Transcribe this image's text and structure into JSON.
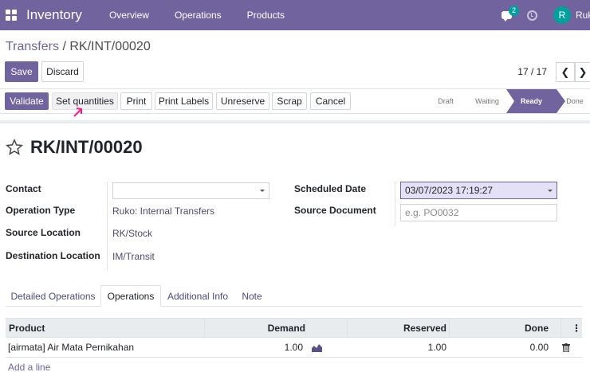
{
  "navbar": {
    "app_name": "Inventory",
    "menu": [
      "Overview",
      "Operations",
      "Products"
    ],
    "chat_count": "2",
    "user_initial": "R",
    "user_name": "Ruko"
  },
  "breadcrumb": {
    "parent": "Transfers",
    "separator": "/",
    "current": "RK/INT/00020"
  },
  "form_actions": {
    "save": "Save",
    "discard": "Discard"
  },
  "pager": {
    "value": "17 / 17"
  },
  "header_buttons": {
    "validate": "Validate",
    "set_quantities": "Set quantities",
    "print": "Print",
    "print_labels": "Print Labels",
    "unreserve": "Unreserve",
    "scrap": "Scrap",
    "cancel": "Cancel"
  },
  "status_stages": {
    "draft": "Draft",
    "waiting": "Waiting",
    "ready": "Ready",
    "done": "Done",
    "current": "Ready"
  },
  "record": {
    "title": "RK/INT/00020"
  },
  "fields": {
    "contact_label": "Contact",
    "contact_value": "",
    "operation_type_label": "Operation Type",
    "operation_type_value": "Ruko: Internal Transfers",
    "source_location_label": "Source Location",
    "source_location_value": "RK/Stock",
    "destination_location_label": "Destination Location",
    "destination_location_value": "IM/Transit",
    "scheduled_date_label": "Scheduled Date",
    "scheduled_date_value": "03/07/2023 17:19:27",
    "source_document_label": "Source Document",
    "source_document_placeholder": "e.g. PO0032"
  },
  "tabs": {
    "detailed_operations": "Detailed Operations",
    "operations": "Operations",
    "additional_info": "Additional Info",
    "note": "Note",
    "active": "Operations"
  },
  "table": {
    "columns": {
      "product": "Product",
      "demand": "Demand",
      "reserved": "Reserved",
      "done": "Done"
    },
    "rows": [
      {
        "product": "[airmata] Air Mata Pernikahan",
        "demand": "1.00",
        "reserved": "1.00",
        "done": "0.00"
      }
    ],
    "add_line": "Add a line"
  },
  "colors": {
    "brand": "#71639e",
    "chat_badge": "#00a09d",
    "date_field_bg": "#e4e0f5",
    "annotation_arrow": "#ff1a8c"
  }
}
